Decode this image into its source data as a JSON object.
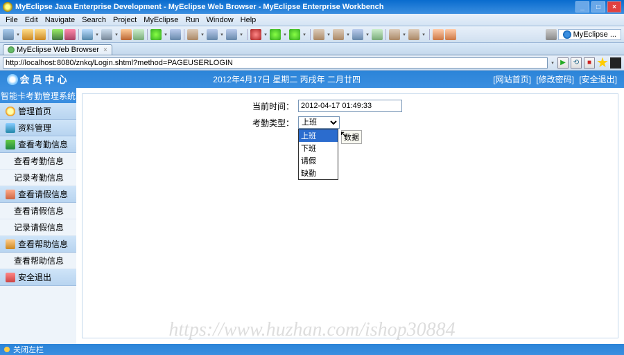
{
  "titlebar": {
    "text": "MyEclipse Java Enterprise Development - MyEclipse Web Browser - MyEclipse Enterprise Workbench"
  },
  "menubar": [
    "File",
    "Edit",
    "Navigate",
    "Search",
    "Project",
    "MyEclipse",
    "Run",
    "Window",
    "Help"
  ],
  "toolbar_right": "MyEclipse ...",
  "tab": {
    "label": "MyEclipse Web Browser"
  },
  "address": "http://localhost:8080/znkq/Login.shtml?method=PAGEUSERLOGIN",
  "sidebar": {
    "header": "会员中心",
    "subtitle": "智能卡考勤管理系统",
    "sections": [
      {
        "label": "管理首页",
        "iconcls": "home",
        "items": []
      },
      {
        "label": "资料管理",
        "iconcls": "data",
        "items": []
      },
      {
        "label": "查看考勤信息",
        "iconcls": "attend",
        "items": [
          "查看考勤信息",
          "记录考勤信息"
        ]
      },
      {
        "label": "查看请假信息",
        "iconcls": "leave",
        "items": [
          "查看请假信息",
          "记录请假信息"
        ]
      },
      {
        "label": "查看帮助信息",
        "iconcls": "help",
        "items": [
          "查看帮助信息"
        ]
      },
      {
        "label": "安全退出",
        "iconcls": "exit",
        "items": []
      }
    ]
  },
  "topbar": {
    "date": "2012年4月17日 星期二 丙戌年 二月廿四",
    "links": [
      "[网站首页]",
      "[修改密码]",
      "[安全退出]"
    ]
  },
  "form": {
    "time_label": "当前时间：",
    "time_value": "2012-04-17 01:49:33",
    "type_label": "考勤类型：",
    "type_selected": "上班",
    "options": [
      "上班",
      "下班",
      "请假",
      "缺勤"
    ],
    "submit_hint": "数据"
  },
  "watermark": "https://www.huzhan.com/ishop30884",
  "statusbar": "关闭左栏"
}
